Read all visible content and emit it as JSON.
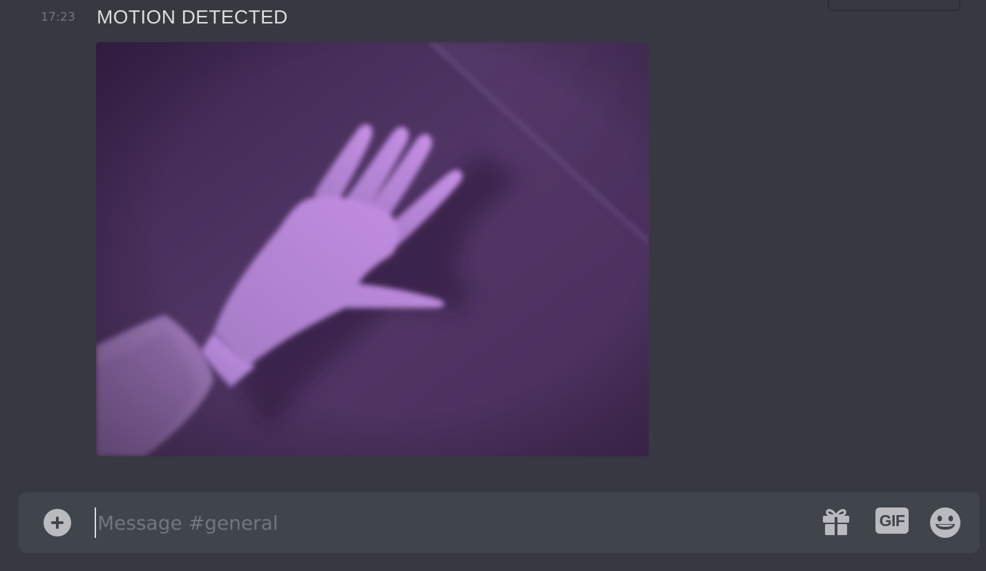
{
  "message": {
    "timestamp": "17:23",
    "text": "MOTION DETECTED"
  },
  "attachment": {
    "description": "photo"
  },
  "composer": {
    "placeholder": "Message #general",
    "gif_label": "GIF"
  },
  "icons": {
    "upload": "plus-circle-icon",
    "gift": "gift-icon",
    "gif": "gif-icon",
    "emoji": "emoji-icon"
  },
  "colors": {
    "background": "#36393f",
    "composer": "#40444b",
    "text": "#dcddde",
    "muted": "#72767d",
    "icon": "#b9bbbe"
  }
}
